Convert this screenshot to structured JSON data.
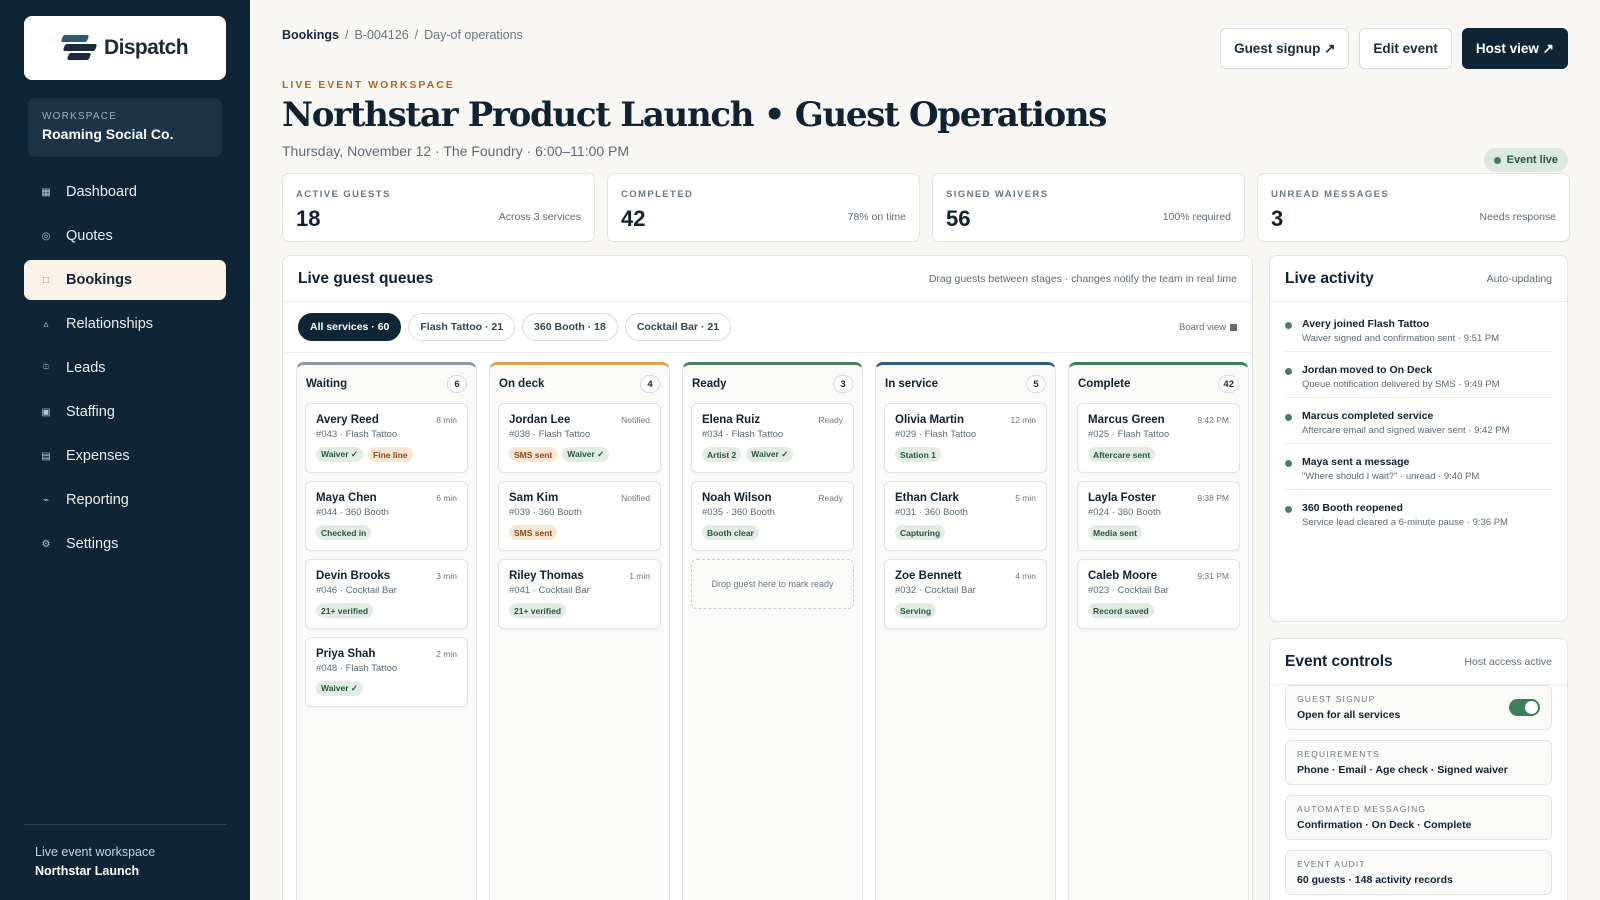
{
  "app": {
    "name": "Dispatch",
    "colors": {
      "sidebar": "#0f2536",
      "accent": "#c0622a",
      "live": "#3c7f5a"
    }
  },
  "workspace": {
    "label": "WORKSPACE",
    "name": "Roaming Social Co."
  },
  "nav": [
    {
      "label": "Dashboard",
      "icon": "grid-icon",
      "glyph": "▦"
    },
    {
      "label": "Quotes",
      "icon": "circle-icon",
      "glyph": "◎"
    },
    {
      "label": "Bookings",
      "icon": "square-icon",
      "glyph": "□",
      "active": true
    },
    {
      "label": "Relationships",
      "icon": "triangle-icon",
      "glyph": "▵"
    },
    {
      "label": "Leads",
      "icon": "cluster-icon",
      "glyph": "⯐"
    },
    {
      "label": "Staffing",
      "icon": "staffing-icon",
      "glyph": "▣"
    },
    {
      "label": "Expenses",
      "icon": "list-icon",
      "glyph": "▤"
    },
    {
      "label": "Reporting",
      "icon": "trend-icon",
      "glyph": "⌁"
    },
    {
      "label": "Settings",
      "icon": "gear-icon",
      "glyph": "⚙"
    }
  ],
  "sidebar_footer": {
    "line1": "Live event workspace",
    "line2": "Northstar Launch"
  },
  "breadcrumb": {
    "root": "Bookings",
    "id": "B-004126",
    "page": "Day-of operations"
  },
  "header_buttons": {
    "guest_signup": "Guest signup ↗",
    "edit_event": "Edit event",
    "host_view": "Host view ↗"
  },
  "eyebrow": "LIVE EVENT WORKSPACE",
  "title": "Northstar Product Launch • Guest Operations",
  "subtitle": "Thursday, November 12 · The Foundry · 6:00–11:00 PM",
  "status_pill": "Event live",
  "stats": [
    {
      "label": "ACTIVE GUESTS",
      "value": "18",
      "note": "Across 3 services"
    },
    {
      "label": "COMPLETED",
      "value": "42",
      "note": "78% on time"
    },
    {
      "label": "SIGNED WAIVERS",
      "value": "56",
      "note": "100% required"
    },
    {
      "label": "UNREAD MESSAGES",
      "value": "3",
      "note": "Needs response"
    }
  ],
  "queues": {
    "title": "Live guest queues",
    "note": "Drag guests between stages · changes notify the team in real time",
    "filters": [
      "All services · 60",
      "Flash Tattoo · 21",
      "360 Booth · 18",
      "Cocktail Bar · 21"
    ],
    "board_view": "Board view",
    "columns": [
      {
        "name": "Waiting",
        "count": "6",
        "color": "#8a9aa3",
        "cards": [
          {
            "name": "Avery Reed",
            "meta": "#043 · Flash Tattoo",
            "time": "8 min",
            "tags": [
              [
                "Waiver ✓",
                "g"
              ],
              [
                "Fine line",
                "o"
              ]
            ]
          },
          {
            "name": "Maya Chen",
            "meta": "#044 · 360 Booth",
            "time": "6 min",
            "tags": [
              [
                "Checked in",
                "g"
              ]
            ]
          },
          {
            "name": "Devin Brooks",
            "meta": "#046 · Cocktail Bar",
            "time": "3 min",
            "tags": [
              [
                "21+ verified",
                "g"
              ]
            ]
          },
          {
            "name": "Priya Shah",
            "meta": "#048 · Flash Tattoo",
            "time": "2 min",
            "tags": [
              [
                "Waiver ✓",
                "g"
              ]
            ]
          }
        ]
      },
      {
        "name": "On deck",
        "count": "4",
        "color": "#e0a150",
        "cards": [
          {
            "name": "Jordan Lee",
            "meta": "#038 · Flash Tattoo",
            "time": "Notified",
            "tags": [
              [
                "SMS sent",
                "o"
              ],
              [
                "Waiver ✓",
                "g"
              ]
            ]
          },
          {
            "name": "Sam Kim",
            "meta": "#039 · 360 Booth",
            "time": "Notified",
            "tags": [
              [
                "SMS sent",
                "o"
              ]
            ]
          },
          {
            "name": "Riley Thomas",
            "meta": "#041 · Cocktail Bar",
            "time": "1 min",
            "tags": [
              [
                "21+ verified",
                "g"
              ]
            ]
          }
        ]
      },
      {
        "name": "Ready",
        "count": "3",
        "color": "#4c7d62",
        "cards": [
          {
            "name": "Elena Ruiz",
            "meta": "#034 · Flash Tattoo",
            "time": "Ready",
            "tags": [
              [
                "Artist 2",
                "g"
              ],
              [
                "Waiver ✓",
                "g"
              ]
            ]
          },
          {
            "name": "Noah Wilson",
            "meta": "#035 · 360 Booth",
            "time": "Ready",
            "tags": [
              [
                "Booth clear",
                "g"
              ]
            ]
          }
        ],
        "drop": "Drop guest here to mark ready"
      },
      {
        "name": "In service",
        "count": "5",
        "color": "#2f5a7e",
        "cards": [
          {
            "name": "Olivia Martin",
            "meta": "#029 · Flash Tattoo",
            "time": "12 min",
            "tags": [
              [
                "Station 1",
                "g"
              ]
            ]
          },
          {
            "name": "Ethan Clark",
            "meta": "#031 · 360 Booth",
            "time": "5 min",
            "tags": [
              [
                "Capturing",
                "g"
              ]
            ]
          },
          {
            "name": "Zoe Bennett",
            "meta": "#032 · Cocktail Bar",
            "time": "4 min",
            "tags": [
              [
                "Serving",
                "g"
              ]
            ]
          }
        ]
      },
      {
        "name": "Complete",
        "count": "42",
        "color": "#3c7f5a",
        "cards": [
          {
            "name": "Marcus Green",
            "meta": "#025 · Flash Tattoo",
            "time": "9:42 PM",
            "tags": [
              [
                "Aftercare sent",
                "g"
              ]
            ]
          },
          {
            "name": "Layla Foster",
            "meta": "#024 · 360 Booth",
            "time": "9:38 PM",
            "tags": [
              [
                "Media sent",
                "g"
              ]
            ]
          },
          {
            "name": "Caleb Moore",
            "meta": "#023 · Cocktail Bar",
            "time": "9:31 PM",
            "tags": [
              [
                "Record saved",
                "g"
              ]
            ]
          }
        ]
      }
    ]
  },
  "activity": {
    "title": "Live activity",
    "note": "Auto-updating",
    "items": [
      {
        "title": "Avery joined Flash Tattoo",
        "detail": "Waiver signed and confirmation sent · 9:51 PM"
      },
      {
        "title": "Jordan moved to On Deck",
        "detail": "Queue notification delivered by SMS · 9:49 PM"
      },
      {
        "title": "Marcus completed service",
        "detail": "Aftercare email and signed waiver sent · 9:42 PM"
      },
      {
        "title": "Maya sent a message",
        "detail": "\"Where should I wait?\" · unread · 9:40 PM"
      },
      {
        "title": "360 Booth reopened",
        "detail": "Service lead cleared a 6-minute pause · 9:36 PM"
      }
    ]
  },
  "controls": {
    "title": "Event controls",
    "note": "Host access active",
    "rows": [
      {
        "key": "GUEST SIGNUP",
        "value": "Open for all services",
        "toggle": true
      },
      {
        "key": "REQUIREMENTS",
        "value": "Phone · Email · Age check · Signed waiver"
      },
      {
        "key": "AUTOMATED MESSAGING",
        "value": "Confirmation · On Deck · Complete"
      },
      {
        "key": "EVENT AUDIT",
        "value": "60 guests · 148 activity records"
      }
    ]
  }
}
